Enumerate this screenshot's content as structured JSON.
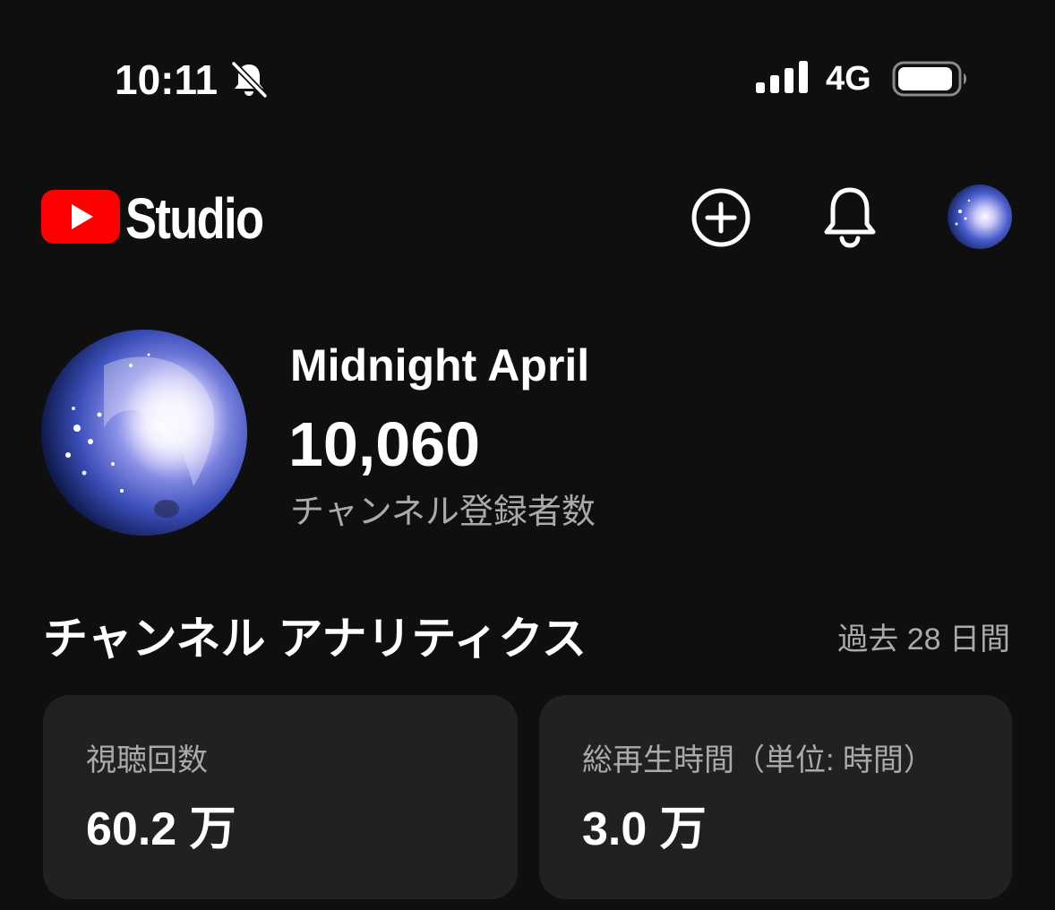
{
  "status_bar": {
    "time": "10:11",
    "network": "4G",
    "icons": [
      "bell-slash-icon",
      "cellular-signal-icon",
      "battery-icon"
    ]
  },
  "header": {
    "app_name": "Studio",
    "icons": [
      "youtube-logo",
      "create-icon",
      "notifications-icon",
      "account-avatar"
    ],
    "brand_color": "#ff0000"
  },
  "channel": {
    "name": "Midnight April",
    "subscriber_count": "10,060",
    "subscriber_label": "チャンネル登録者数"
  },
  "analytics": {
    "title": "チャンネル アナリティクス",
    "period": "過去 28 日間",
    "metrics": [
      {
        "label": "視聴回数",
        "value": "60.2 万"
      },
      {
        "label": "総再生時間（単位: 時間）",
        "value": "3.0 万"
      }
    ]
  },
  "colors": {
    "background": "#0f0f0f",
    "card": "#212121",
    "secondary_text": "#aaaaaa"
  }
}
